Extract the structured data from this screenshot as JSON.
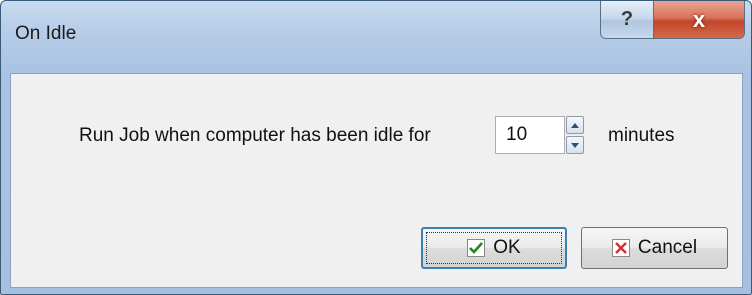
{
  "window": {
    "title": "On Idle",
    "help_glyph": "?",
    "close_glyph": "x"
  },
  "dialog": {
    "prompt": "Run Job when computer has been idle for",
    "minutes_value": "10",
    "unit": "minutes"
  },
  "buttons": {
    "ok_label": "OK",
    "cancel_label": "Cancel"
  },
  "icons": {
    "ok": "checkmark-icon",
    "cancel": "x-icon",
    "spin_up": "up-arrow-icon",
    "spin_down": "down-arrow-icon"
  },
  "colors": {
    "check_green": "#1e8a1e",
    "cancel_red": "#d32f2f"
  }
}
